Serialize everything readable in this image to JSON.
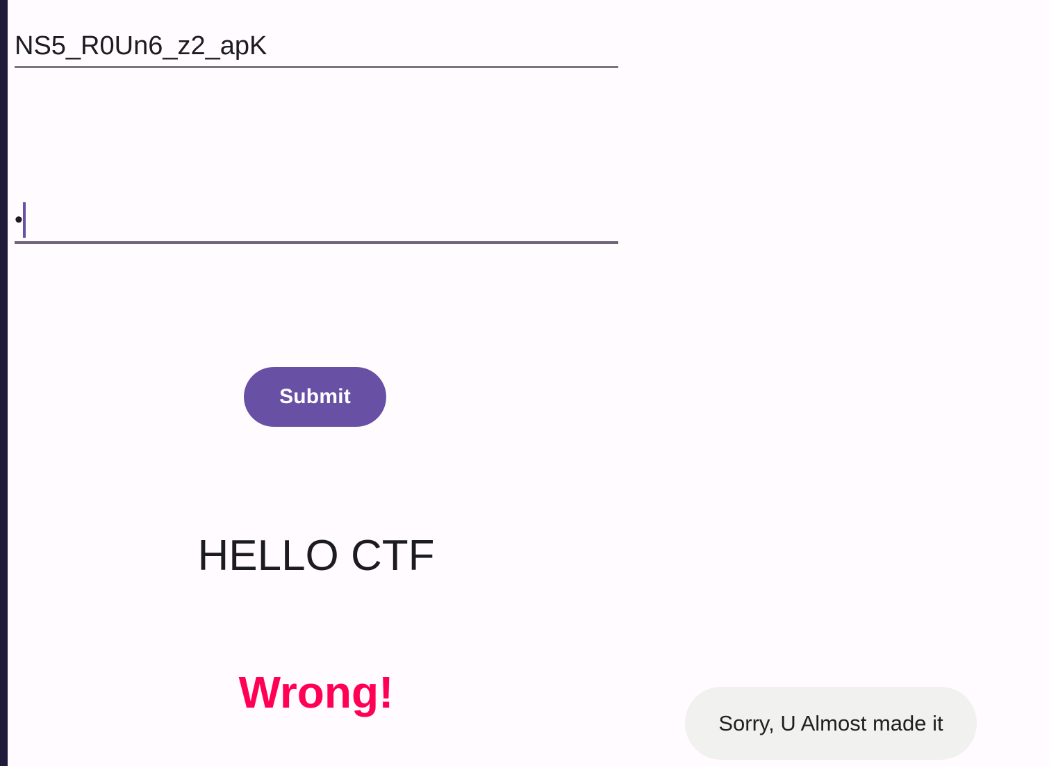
{
  "form": {
    "first_field_value": "NS5_R0Un6_z2_apK",
    "second_field_value": "•",
    "submit_label": "Submit"
  },
  "main": {
    "title": "HELLO CTF",
    "result": "Wrong!"
  },
  "toast": {
    "message": "Sorry, U Almost made it"
  },
  "colors": {
    "accent": "#6851a5",
    "error": "#ff0055",
    "background": "#fffbfe",
    "toast_background": "#f1f1f0"
  }
}
